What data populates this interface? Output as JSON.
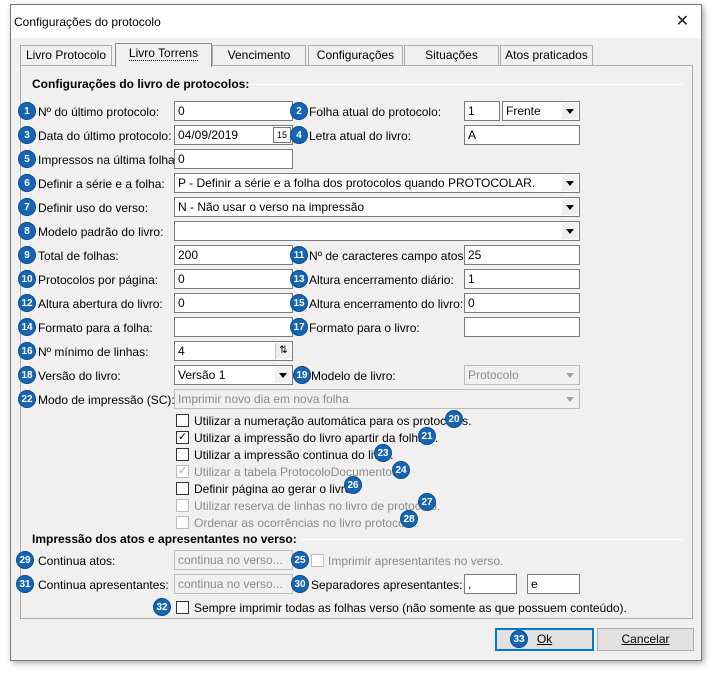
{
  "window": {
    "title": "Configurações do protocolo",
    "close_glyph": "✕"
  },
  "tabs": [
    "Livro Protocolo",
    "Livro Torrens",
    "Vencimento",
    "Configurações",
    "Situações",
    "Atos praticados"
  ],
  "sections": {
    "config": "Configurações do livro de protocolos:",
    "impressao": "Impressão dos atos e apresentantes no verso:"
  },
  "badges": [
    "1",
    "2",
    "3",
    "4",
    "5",
    "6",
    "7",
    "8",
    "9",
    "10",
    "11",
    "12",
    "13",
    "14",
    "15",
    "16",
    "17",
    "18",
    "19",
    "20",
    "21",
    "22",
    "23",
    "24",
    "25",
    "26",
    "27",
    "28",
    "29",
    "30",
    "31",
    "32",
    "33"
  ],
  "fields": {
    "ultimo_protocolo": {
      "label": "Nº do último protocolo:",
      "value": "0"
    },
    "folha_atual": {
      "label": "Folha atual do protocolo:",
      "value": "1",
      "side": "Frente"
    },
    "data_ultimo": {
      "label": "Data do último protocolo:",
      "value": "04/09/2019",
      "cal": "15"
    },
    "letra_atual": {
      "label": "Letra atual do livro:",
      "value": "A"
    },
    "impressos_ultima": {
      "label": "Impressos na última folha:",
      "value": "0"
    },
    "serie_folha": {
      "label": "Definir a série e a folha:",
      "value": "P - Definir a série e a folha dos protocolos quando PROTOCOLAR."
    },
    "uso_verso": {
      "label": "Definir uso do verso:",
      "value": "N - Não usar o verso na impressão"
    },
    "modelo_padrao": {
      "label": "Modelo padrão do livro:",
      "value": ""
    },
    "total_folhas": {
      "label": "Total de folhas:",
      "value": "200"
    },
    "caracteres_atos": {
      "label": "Nº de caracteres campo atos:",
      "value": "25"
    },
    "protocolos_pagina": {
      "label": "Protocolos por página:",
      "value": "0"
    },
    "altura_diario": {
      "label": "Altura encerramento diário:",
      "value": "1"
    },
    "altura_abertura": {
      "label": "Altura abertura do livro:",
      "value": "0"
    },
    "altura_enc_livro": {
      "label": "Altura encerramento do livro:",
      "value": "0"
    },
    "formato_folha": {
      "label": "Formato para a folha:",
      "value": ""
    },
    "formato_livro": {
      "label": "Formato para o livro:",
      "value": ""
    },
    "minimo_linhas": {
      "label": "Nº mínimo de linhas:",
      "value": "4",
      "spin": "⇅"
    },
    "versao_livro": {
      "label": "Versão do livro:",
      "value": "Versão 1"
    },
    "modelo_livro": {
      "label": "Modelo de livro:",
      "value": "Protocolo"
    },
    "modo_impressao": {
      "label": "Modo de impressão (SC):",
      "value": "Imprimir novo dia em nova folha"
    },
    "continua_atos": {
      "label": "Continua atos:",
      "placeholder": "continua no verso..."
    },
    "continua_apresentantes": {
      "label": "Continua apresentantes:",
      "placeholder": "continua no verso..."
    },
    "separadores": {
      "label": "Separadores apresentantes:",
      "value1": ",",
      "value2": "e"
    }
  },
  "checkboxes": {
    "numeracao": {
      "label": "Utilizar a numeração automática para os protocolos.",
      "checked": ""
    },
    "apartir_folha": {
      "label": "Utilizar a impressão do livro apartir da folha 1.",
      "checked": "✓"
    },
    "continua": {
      "label": "Utilizar a impressão continua do livro.",
      "checked": ""
    },
    "tabela": {
      "label": "Utilizar a tabela ProtocoloDocumentos.",
      "checked": "✓"
    },
    "definir_pagina": {
      "label": "Definir página ao gerar o livro.",
      "checked": ""
    },
    "reserva": {
      "label": "Utilizar reserva de linhas no livro de protocolo.",
      "checked": ""
    },
    "ordenar": {
      "label": "Ordenar as ocorrências no livro protocolo.",
      "checked": ""
    },
    "imprimir_apresentantes": {
      "label": "Imprimir apresentantes no verso.",
      "checked": ""
    },
    "sempre_imprimir": {
      "label": "Sempre imprimir todas as folhas verso (não somente as que possuem conteúdo).",
      "checked": ""
    }
  },
  "buttons": {
    "ok": "Ok",
    "cancel": "Cancelar"
  }
}
